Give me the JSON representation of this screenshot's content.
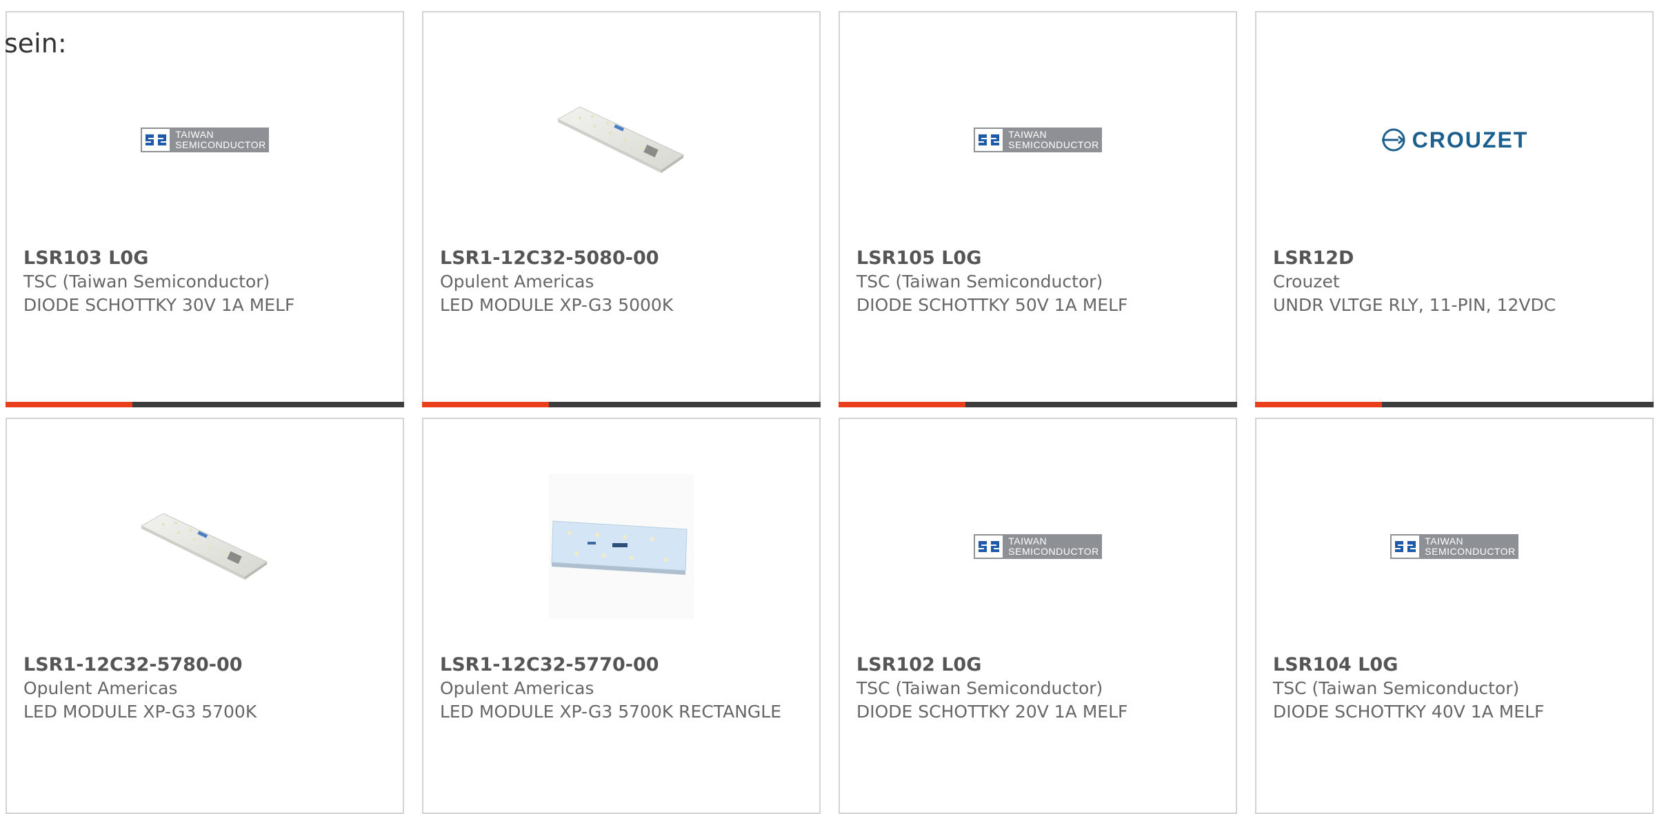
{
  "intro_text": "sein:",
  "colors": {
    "accent": "#e8401c",
    "bar_dark": "#3d3d3d",
    "card_border": "#d3d3d3",
    "text": "#666666",
    "crouzet_blue": "#1a5f8e"
  },
  "logos": {
    "tsc": {
      "line1": "TAIWAN",
      "line2": "SEMICONDUCTOR"
    },
    "crouzet": {
      "name": "CROUZET"
    }
  },
  "products": [
    {
      "part_number": "LSR103 L0G",
      "manufacturer": "TSC (Taiwan Semiconductor)",
      "description": "DIODE SCHOTTKY 30V 1A MELF",
      "image": "tsc-logo"
    },
    {
      "part_number": "LSR1-12C32-5080-00",
      "manufacturer": "Opulent Americas",
      "description": "LED MODULE XP-G3 5000K",
      "image": "led-module-photo"
    },
    {
      "part_number": "LSR105 L0G",
      "manufacturer": "TSC (Taiwan Semiconductor)",
      "description": "DIODE SCHOTTKY 50V 1A MELF",
      "image": "tsc-logo"
    },
    {
      "part_number": "LSR12D",
      "manufacturer": "Crouzet",
      "description": "UNDR VLTGE RLY, 11-PIN, 12VDC",
      "image": "crouzet-logo"
    },
    {
      "part_number": "LSR1-12C32-5780-00",
      "manufacturer": "Opulent Americas",
      "description": "LED MODULE XP-G3 5700K",
      "image": "led-module-photo"
    },
    {
      "part_number": "LSR1-12C32-5770-00",
      "manufacturer": "Opulent Americas",
      "description": "LED MODULE XP-G3 5700K RECTANGLE",
      "image": "led-rectangle-photo"
    },
    {
      "part_number": "LSR102 L0G",
      "manufacturer": "TSC (Taiwan Semiconductor)",
      "description": "DIODE SCHOTTKY 20V 1A MELF",
      "image": "tsc-logo"
    },
    {
      "part_number": "LSR104 L0G",
      "manufacturer": "TSC (Taiwan Semiconductor)",
      "description": "DIODE SCHOTTKY 40V 1A MELF",
      "image": "tsc-logo"
    }
  ]
}
